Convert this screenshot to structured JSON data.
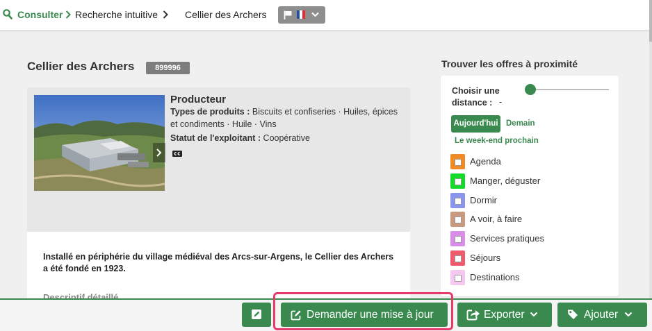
{
  "breadcrumb": {
    "root": "Consulter",
    "level2": "Recherche intuitive",
    "current": "Cellier des Archers"
  },
  "language": {
    "selected_flag": "fr"
  },
  "establishment": {
    "name": "Cellier des Archers",
    "id": "899996",
    "category": "Producteur",
    "products_label": "Types de produits :",
    "products_value": "Biscuits et confiseries · Huiles, épices et condiments · Huile · Vins",
    "operator_label": "Statut de l'exploitant :",
    "operator_value": "Coopérative",
    "description": "Installé en périphérie du village médiéval des Arcs-sur-Argens, le Cellier des Archers a été fondé en 1923.",
    "description_title": "Descriptif détaillé"
  },
  "nearby": {
    "title": "Trouver les offres à proximité",
    "distance_label": "Choisir une distance :",
    "distance_value": "-",
    "distance_level": 0,
    "today": "Aujourd'hui",
    "tomorrow": "Demain",
    "weekend": "Le week-end prochain",
    "categories": [
      {
        "label": "Agenda",
        "color": "#f08a24"
      },
      {
        "label": "Manger, déguster",
        "color": "#13d92a"
      },
      {
        "label": "Dormir",
        "color": "#8a96ec"
      },
      {
        "label": "A voir, à faire",
        "color": "#c99a7f"
      },
      {
        "label": "Services pratiques",
        "color": "#d98de8"
      },
      {
        "label": "Séjours",
        "color": "#ef5a6c"
      },
      {
        "label": "Destinations",
        "color": "#f5c8ef"
      }
    ]
  },
  "actions": {
    "request_update": "Demander une mise à jour",
    "export": "Exporter",
    "add": "Ajouter"
  },
  "colors": {
    "accent": "#3a8a4f",
    "highlight": "#e73b6c"
  }
}
